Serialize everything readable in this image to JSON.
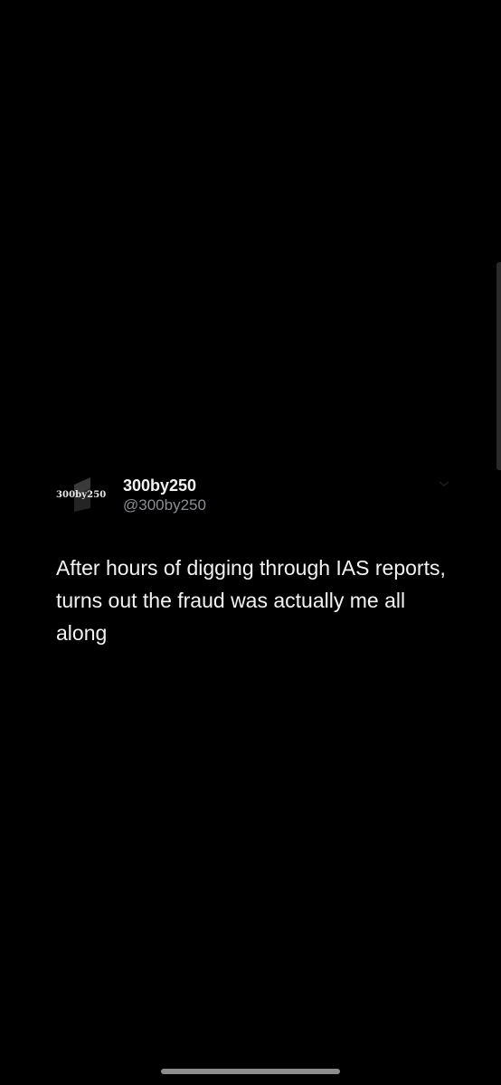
{
  "tweet": {
    "avatar_text": "300by250",
    "display_name": "300by250",
    "handle": "@300by250",
    "text": "After hours of digging through IAS reports, turns out the fraud was actually me all along"
  },
  "icons": {
    "avatar": "logo-avatar-icon",
    "options": "chevron-down-icon"
  },
  "colors": {
    "background": "#000000",
    "primary_text": "#f2f2f2",
    "secondary_text": "#8a8d91"
  }
}
